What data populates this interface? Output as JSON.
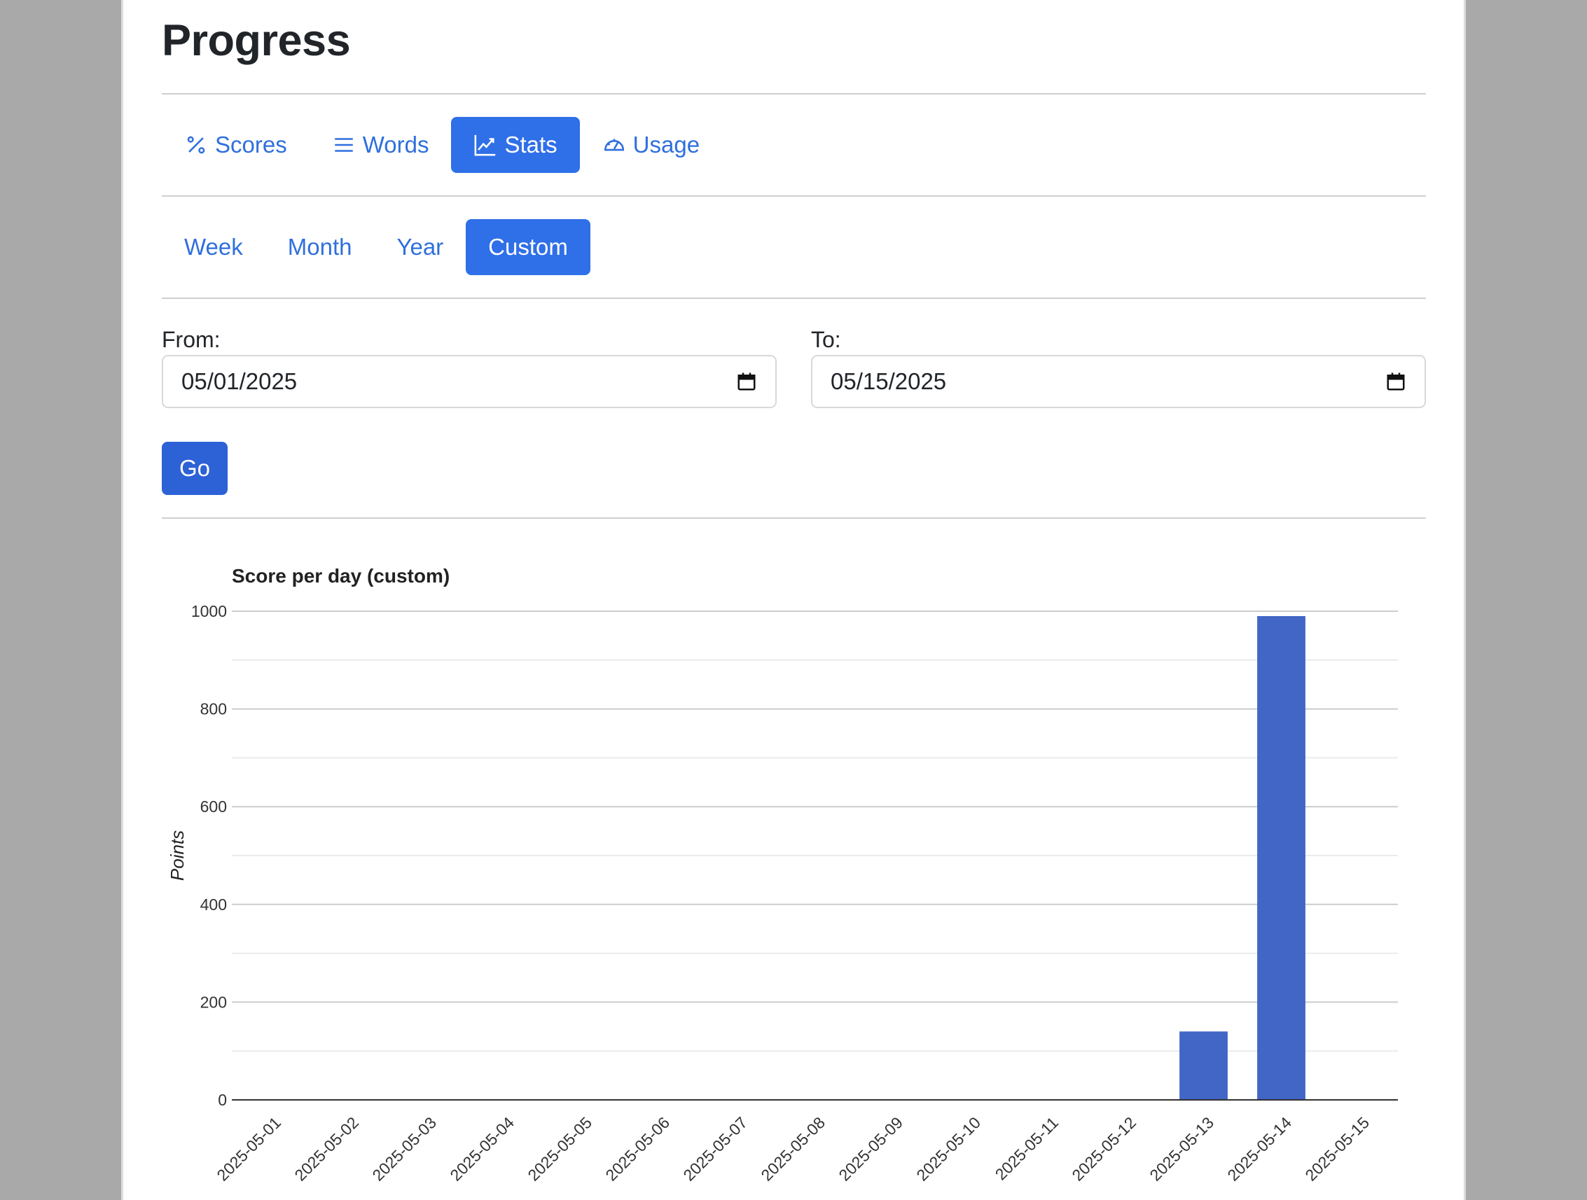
{
  "page": {
    "title": "Progress"
  },
  "tabs": [
    {
      "label": "Scores",
      "icon": "percent-icon",
      "active": false
    },
    {
      "label": "Words",
      "icon": "list-icon",
      "active": false
    },
    {
      "label": "Stats",
      "icon": "line-chart-icon",
      "active": true
    },
    {
      "label": "Usage",
      "icon": "speedometer-icon",
      "active": false
    }
  ],
  "ranges": [
    {
      "label": "Week",
      "active": false
    },
    {
      "label": "Month",
      "active": false
    },
    {
      "label": "Year",
      "active": false
    },
    {
      "label": "Custom",
      "active": true
    }
  ],
  "filter": {
    "from_label": "From:",
    "from_value": "05/01/2025",
    "to_label": "To:",
    "to_value": "05/15/2025",
    "go_label": "Go"
  },
  "colors": {
    "accent": "#2f6fe8",
    "bar": "#4266c6",
    "link": "#2f6fdd"
  },
  "chart_data": {
    "type": "bar",
    "title": "Score per day (custom)",
    "xlabel": "",
    "ylabel": "Points",
    "ylim": [
      0,
      1000
    ],
    "yticks": [
      0,
      200,
      400,
      600,
      800,
      1000
    ],
    "grid": true,
    "categories": [
      "2025-05-01",
      "2025-05-02",
      "2025-05-03",
      "2025-05-04",
      "2025-05-05",
      "2025-05-06",
      "2025-05-07",
      "2025-05-08",
      "2025-05-09",
      "2025-05-10",
      "2025-05-11",
      "2025-05-12",
      "2025-05-13",
      "2025-05-14",
      "2025-05-15"
    ],
    "values": [
      0,
      0,
      0,
      0,
      0,
      0,
      0,
      0,
      0,
      0,
      0,
      0,
      140,
      990,
      0
    ]
  }
}
